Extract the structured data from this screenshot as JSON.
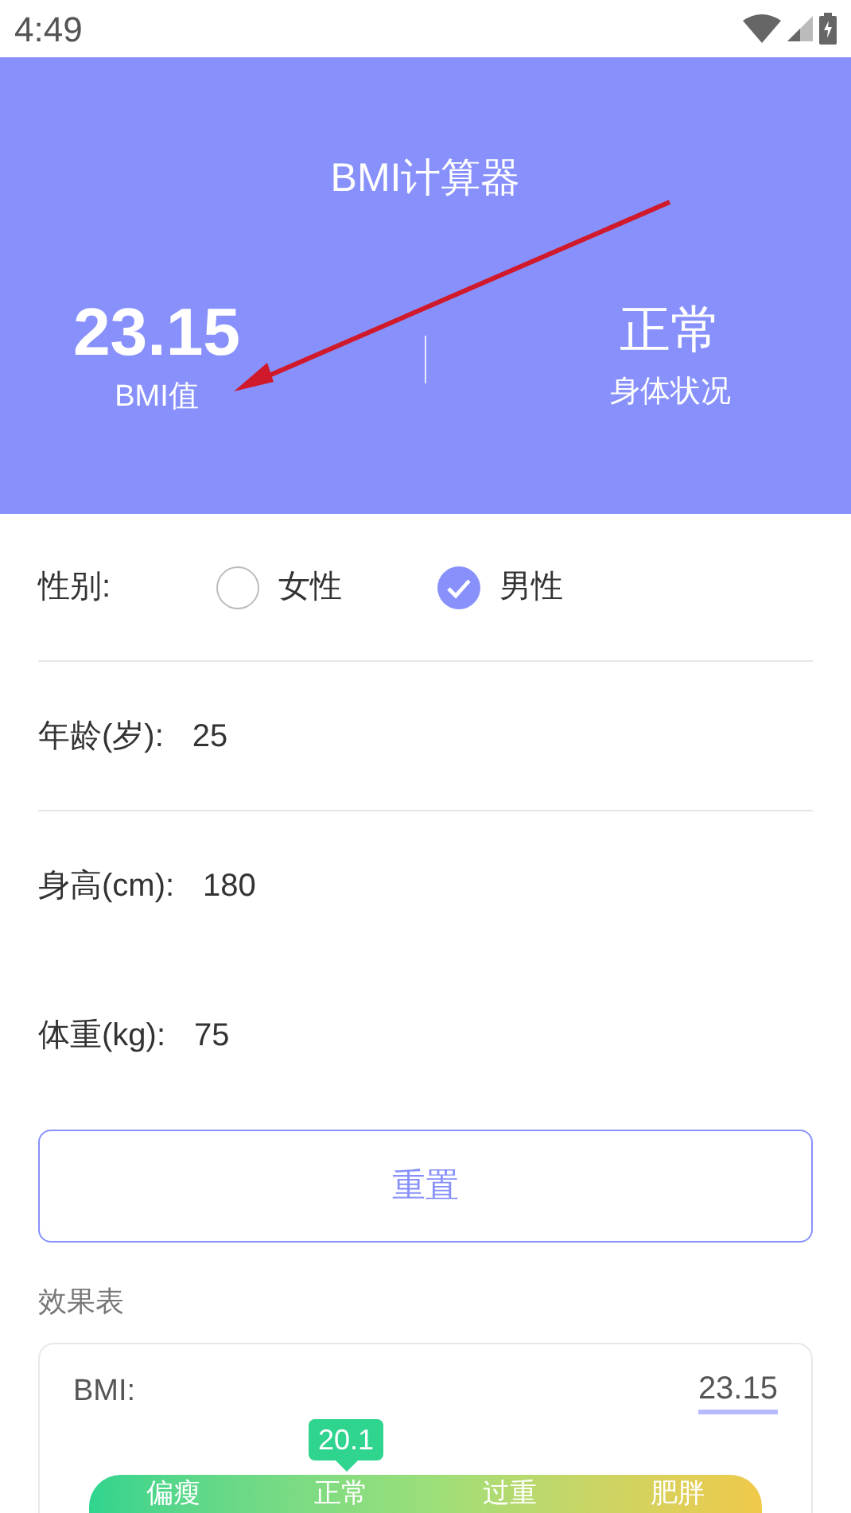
{
  "status_bar": {
    "time": "4:49"
  },
  "header": {
    "title": "BMI计算器",
    "bmi_value": "23.15",
    "bmi_label": "BMI值",
    "status_value": "正常",
    "status_label": "身体状况"
  },
  "form": {
    "gender": {
      "label": "性别:",
      "options": [
        {
          "label": "女性",
          "selected": false
        },
        {
          "label": "男性",
          "selected": true
        }
      ]
    },
    "fields": [
      {
        "label": "年龄(岁):",
        "value": "25",
        "divider": true
      },
      {
        "label": "身高(cm):",
        "value": "180",
        "divider": false
      },
      {
        "label": "体重(kg):",
        "value": "75",
        "divider": false
      }
    ]
  },
  "reset_button": "重置",
  "effect_table": {
    "heading": "效果表",
    "bmi_label": "BMI:",
    "bmi_value": "23.15",
    "marker": {
      "text": "20.1"
    },
    "scale": [
      "偏瘦",
      "正常",
      "过重",
      "肥胖"
    ]
  }
}
